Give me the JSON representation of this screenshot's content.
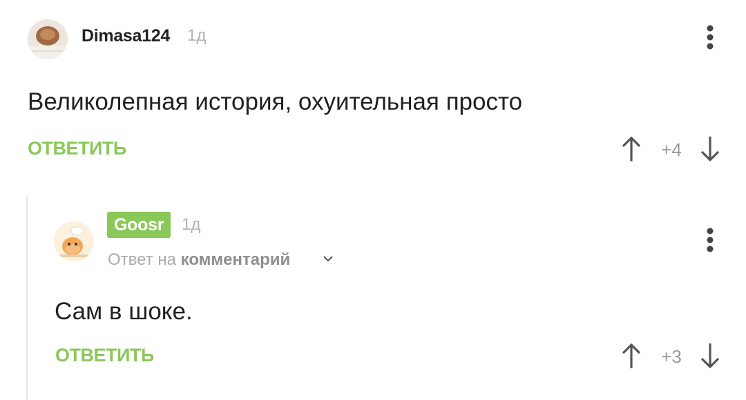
{
  "comments": [
    {
      "author": "Dimasa124",
      "time": "1д",
      "text": "Великолепная история, охуительная просто",
      "reply_label": "ОТВЕТИТЬ",
      "score": "+4"
    },
    {
      "author": "Goosr",
      "time": "1д",
      "reply_to_prefix": "Ответ на",
      "reply_to_link": "комментарий",
      "text": "Сам в шоке.",
      "reply_label": "ОТВЕТИТЬ",
      "score": "+3"
    }
  ],
  "icons": {
    "menu": "more-vertical-icon",
    "upvote": "arrow-up-icon",
    "downvote": "arrow-down-icon",
    "expand": "chevron-down-icon"
  },
  "colors": {
    "accent_green": "#8ac858",
    "muted_text": "#9a9a9a",
    "timestamp": "#b3b3b3",
    "body_text": "#222222",
    "thread_line": "#e6e6e6"
  }
}
